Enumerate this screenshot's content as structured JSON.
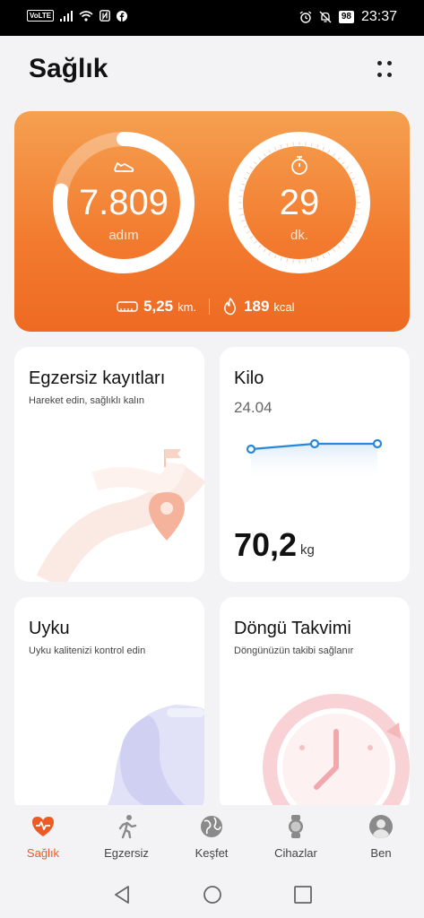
{
  "status_bar": {
    "volte": "VoLTE",
    "battery": "98",
    "time": "23:37"
  },
  "header": {
    "title": "Sağlık"
  },
  "activity": {
    "steps": {
      "value": "7.809",
      "unit": "adım",
      "progress": 0.78
    },
    "minutes": {
      "value": "29",
      "unit": "dk.",
      "progress": 1.0
    },
    "distance": {
      "value": "5,25",
      "unit": "km."
    },
    "calories": {
      "value": "189",
      "unit": "kcal"
    }
  },
  "cards": {
    "exercise": {
      "title": "Egzersiz kayıtları",
      "subtitle": "Hareket edin, sağlıklı kalın"
    },
    "weight": {
      "title": "Kilo",
      "date": "24.04",
      "value": "70,2",
      "unit": "kg"
    },
    "sleep": {
      "title": "Uyku",
      "subtitle": "Uyku kalitenizi kontrol edin"
    },
    "cycle": {
      "title": "Döngü Takvimi",
      "subtitle": "Döngünüzün takibi sağlanır"
    }
  },
  "nav": {
    "items": [
      {
        "label": "Sağlık",
        "icon": "heart-icon",
        "active": true
      },
      {
        "label": "Egzersiz",
        "icon": "runner-icon",
        "active": false
      },
      {
        "label": "Keşfet",
        "icon": "globe-icon",
        "active": false
      },
      {
        "label": "Cihazlar",
        "icon": "watch-icon",
        "active": false
      },
      {
        "label": "Ben",
        "icon": "person-icon",
        "active": false
      }
    ]
  },
  "colors": {
    "accent": "#ee5a24",
    "hero_top": "#f5a050",
    "hero_bottom": "#ee6a22",
    "chart_line": "#2a86d6"
  }
}
